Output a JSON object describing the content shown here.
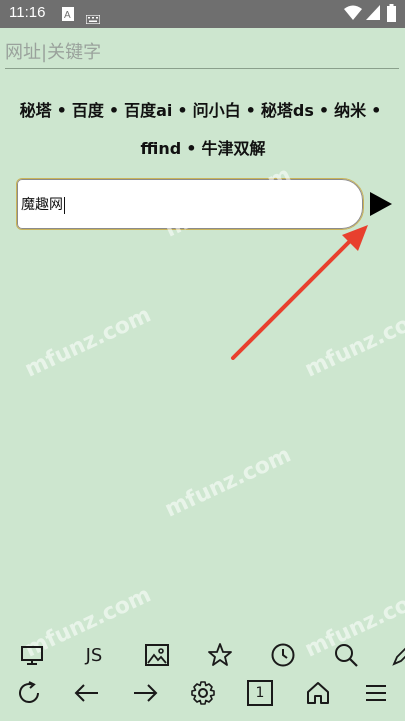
{
  "status_bar": {
    "time": "11:16"
  },
  "url_bar": {
    "placeholder": "网址|关键字"
  },
  "engines": [
    {
      "label": "秘塔"
    },
    {
      "label": "百度"
    },
    {
      "label": "百度ai"
    },
    {
      "label": "问小白"
    },
    {
      "label": "秘塔ds"
    },
    {
      "label": "纳米"
    },
    {
      "label": "ffind"
    },
    {
      "label": "牛津双解"
    }
  ],
  "separator": "•",
  "search": {
    "value": "魔趣网"
  },
  "watermarks": [
    "mfunz.com",
    "mfunz.com",
    "mfunz.com",
    "mfunz.com",
    "mfunz.com",
    "mfunz.com"
  ],
  "toolbar_top": {
    "js_label": "JS",
    "icons": [
      "desktop-icon",
      "js-icon",
      "image-icon",
      "star-icon",
      "clock-icon",
      "search-icon",
      "pen-icon"
    ]
  },
  "toolbar_bottom": {
    "tab_count": "1",
    "icons": [
      "refresh-icon",
      "back-icon",
      "forward-icon",
      "settings-icon",
      "tabs-icon",
      "home-icon",
      "menu-icon"
    ]
  },
  "colors": {
    "background": "#cde6cf",
    "status_bar": "#6f6f6f",
    "arrow": "#e8402e"
  }
}
